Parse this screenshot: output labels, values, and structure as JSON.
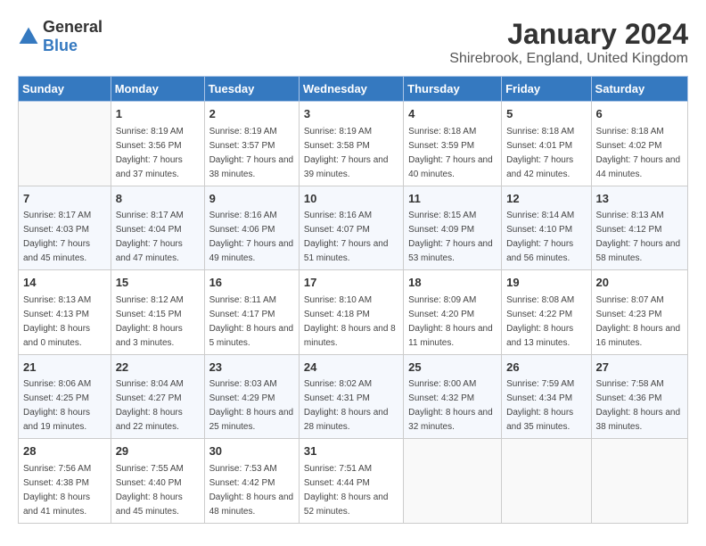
{
  "logo": {
    "line1": "General",
    "line2": "Blue"
  },
  "title": "January 2024",
  "subtitle": "Shirebrook, England, United Kingdom",
  "days_of_week": [
    "Sunday",
    "Monday",
    "Tuesday",
    "Wednesday",
    "Thursday",
    "Friday",
    "Saturday"
  ],
  "weeks": [
    [
      {
        "day": "",
        "sunrise": "",
        "sunset": "",
        "daylight": ""
      },
      {
        "day": "1",
        "sunrise": "Sunrise: 8:19 AM",
        "sunset": "Sunset: 3:56 PM",
        "daylight": "Daylight: 7 hours and 37 minutes."
      },
      {
        "day": "2",
        "sunrise": "Sunrise: 8:19 AM",
        "sunset": "Sunset: 3:57 PM",
        "daylight": "Daylight: 7 hours and 38 minutes."
      },
      {
        "day": "3",
        "sunrise": "Sunrise: 8:19 AM",
        "sunset": "Sunset: 3:58 PM",
        "daylight": "Daylight: 7 hours and 39 minutes."
      },
      {
        "day": "4",
        "sunrise": "Sunrise: 8:18 AM",
        "sunset": "Sunset: 3:59 PM",
        "daylight": "Daylight: 7 hours and 40 minutes."
      },
      {
        "day": "5",
        "sunrise": "Sunrise: 8:18 AM",
        "sunset": "Sunset: 4:01 PM",
        "daylight": "Daylight: 7 hours and 42 minutes."
      },
      {
        "day": "6",
        "sunrise": "Sunrise: 8:18 AM",
        "sunset": "Sunset: 4:02 PM",
        "daylight": "Daylight: 7 hours and 44 minutes."
      }
    ],
    [
      {
        "day": "7",
        "sunrise": "Sunrise: 8:17 AM",
        "sunset": "Sunset: 4:03 PM",
        "daylight": "Daylight: 7 hours and 45 minutes."
      },
      {
        "day": "8",
        "sunrise": "Sunrise: 8:17 AM",
        "sunset": "Sunset: 4:04 PM",
        "daylight": "Daylight: 7 hours and 47 minutes."
      },
      {
        "day": "9",
        "sunrise": "Sunrise: 8:16 AM",
        "sunset": "Sunset: 4:06 PM",
        "daylight": "Daylight: 7 hours and 49 minutes."
      },
      {
        "day": "10",
        "sunrise": "Sunrise: 8:16 AM",
        "sunset": "Sunset: 4:07 PM",
        "daylight": "Daylight: 7 hours and 51 minutes."
      },
      {
        "day": "11",
        "sunrise": "Sunrise: 8:15 AM",
        "sunset": "Sunset: 4:09 PM",
        "daylight": "Daylight: 7 hours and 53 minutes."
      },
      {
        "day": "12",
        "sunrise": "Sunrise: 8:14 AM",
        "sunset": "Sunset: 4:10 PM",
        "daylight": "Daylight: 7 hours and 56 minutes."
      },
      {
        "day": "13",
        "sunrise": "Sunrise: 8:13 AM",
        "sunset": "Sunset: 4:12 PM",
        "daylight": "Daylight: 7 hours and 58 minutes."
      }
    ],
    [
      {
        "day": "14",
        "sunrise": "Sunrise: 8:13 AM",
        "sunset": "Sunset: 4:13 PM",
        "daylight": "Daylight: 8 hours and 0 minutes."
      },
      {
        "day": "15",
        "sunrise": "Sunrise: 8:12 AM",
        "sunset": "Sunset: 4:15 PM",
        "daylight": "Daylight: 8 hours and 3 minutes."
      },
      {
        "day": "16",
        "sunrise": "Sunrise: 8:11 AM",
        "sunset": "Sunset: 4:17 PM",
        "daylight": "Daylight: 8 hours and 5 minutes."
      },
      {
        "day": "17",
        "sunrise": "Sunrise: 8:10 AM",
        "sunset": "Sunset: 4:18 PM",
        "daylight": "Daylight: 8 hours and 8 minutes."
      },
      {
        "day": "18",
        "sunrise": "Sunrise: 8:09 AM",
        "sunset": "Sunset: 4:20 PM",
        "daylight": "Daylight: 8 hours and 11 minutes."
      },
      {
        "day": "19",
        "sunrise": "Sunrise: 8:08 AM",
        "sunset": "Sunset: 4:22 PM",
        "daylight": "Daylight: 8 hours and 13 minutes."
      },
      {
        "day": "20",
        "sunrise": "Sunrise: 8:07 AM",
        "sunset": "Sunset: 4:23 PM",
        "daylight": "Daylight: 8 hours and 16 minutes."
      }
    ],
    [
      {
        "day": "21",
        "sunrise": "Sunrise: 8:06 AM",
        "sunset": "Sunset: 4:25 PM",
        "daylight": "Daylight: 8 hours and 19 minutes."
      },
      {
        "day": "22",
        "sunrise": "Sunrise: 8:04 AM",
        "sunset": "Sunset: 4:27 PM",
        "daylight": "Daylight: 8 hours and 22 minutes."
      },
      {
        "day": "23",
        "sunrise": "Sunrise: 8:03 AM",
        "sunset": "Sunset: 4:29 PM",
        "daylight": "Daylight: 8 hours and 25 minutes."
      },
      {
        "day": "24",
        "sunrise": "Sunrise: 8:02 AM",
        "sunset": "Sunset: 4:31 PM",
        "daylight": "Daylight: 8 hours and 28 minutes."
      },
      {
        "day": "25",
        "sunrise": "Sunrise: 8:00 AM",
        "sunset": "Sunset: 4:32 PM",
        "daylight": "Daylight: 8 hours and 32 minutes."
      },
      {
        "day": "26",
        "sunrise": "Sunrise: 7:59 AM",
        "sunset": "Sunset: 4:34 PM",
        "daylight": "Daylight: 8 hours and 35 minutes."
      },
      {
        "day": "27",
        "sunrise": "Sunrise: 7:58 AM",
        "sunset": "Sunset: 4:36 PM",
        "daylight": "Daylight: 8 hours and 38 minutes."
      }
    ],
    [
      {
        "day": "28",
        "sunrise": "Sunrise: 7:56 AM",
        "sunset": "Sunset: 4:38 PM",
        "daylight": "Daylight: 8 hours and 41 minutes."
      },
      {
        "day": "29",
        "sunrise": "Sunrise: 7:55 AM",
        "sunset": "Sunset: 4:40 PM",
        "daylight": "Daylight: 8 hours and 45 minutes."
      },
      {
        "day": "30",
        "sunrise": "Sunrise: 7:53 AM",
        "sunset": "Sunset: 4:42 PM",
        "daylight": "Daylight: 8 hours and 48 minutes."
      },
      {
        "day": "31",
        "sunrise": "Sunrise: 7:51 AM",
        "sunset": "Sunset: 4:44 PM",
        "daylight": "Daylight: 8 hours and 52 minutes."
      },
      {
        "day": "",
        "sunrise": "",
        "sunset": "",
        "daylight": ""
      },
      {
        "day": "",
        "sunrise": "",
        "sunset": "",
        "daylight": ""
      },
      {
        "day": "",
        "sunrise": "",
        "sunset": "",
        "daylight": ""
      }
    ]
  ]
}
